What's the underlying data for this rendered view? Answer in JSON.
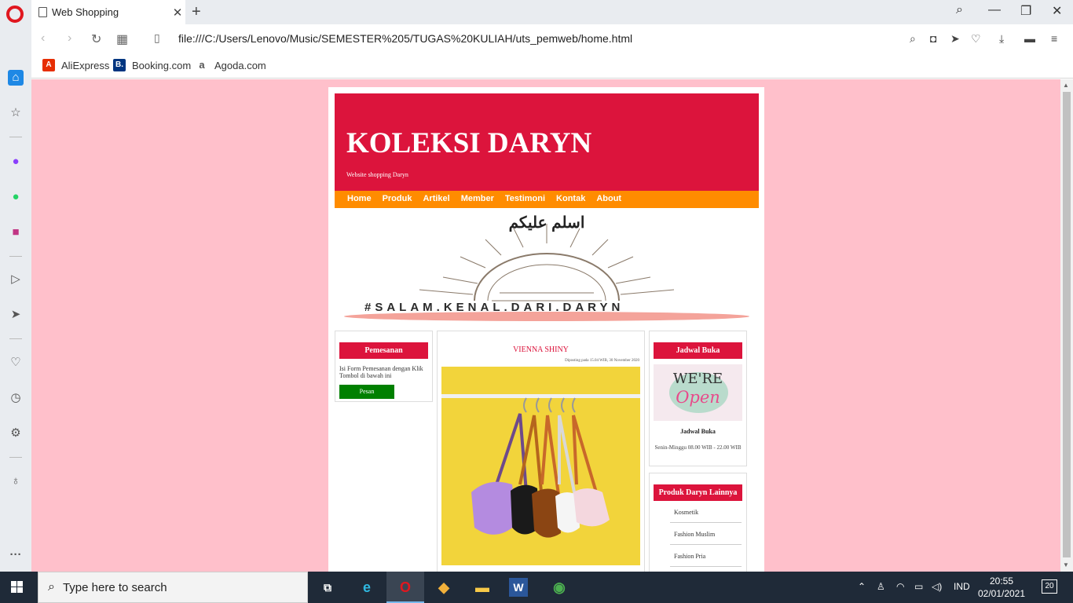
{
  "browser": {
    "tab_title": "Web Shopping",
    "url": "file:///C:/Users/Lenovo/Music/SEMESTER%205/TUGAS%20KULIAH/uts_pemweb/home.html",
    "bookmarks": [
      "AliExpress",
      "Booking.com",
      "Agoda.com"
    ]
  },
  "site": {
    "title": "KOLEKSI DARYN",
    "subtitle": "Website shopping Daryn",
    "menu": [
      "Home",
      "Produk",
      "Artikel",
      "Member",
      "Testimoni",
      "Kontak",
      "About"
    ],
    "banner": {
      "arabic": "اسلم عليكم",
      "tagline": "#SALAM.KENAL.DARI.DARYN"
    },
    "left_panel": {
      "heading": "Pemesanan",
      "text": "Isi Form Pemesanan dengan Klik Tombol di bawah ini",
      "button": "Pesan"
    },
    "product": {
      "title": "VIENNA SHINY",
      "posted": "Diposting pada 15.04 WIB, 30 November 2020"
    },
    "schedule": {
      "heading": "Jadwal Buka",
      "image_text_top": "WE'RE",
      "image_text_bottom": "Open",
      "caption": "Jadwal Buka",
      "hours": "Senin-Minggu 08.00 WIB - 22.00 WIB"
    },
    "other_products": {
      "heading": "Produk Daryn Lainnya",
      "items": [
        "Kosmetik",
        "Fashion Muslim",
        "Fashion Pria"
      ]
    }
  },
  "taskbar": {
    "search_placeholder": "Type here to search",
    "language": "IND",
    "time": "20:55",
    "date": "02/01/2021",
    "notifications": "20"
  },
  "colors": {
    "page_bg": "#ffc0cb",
    "header": "#dc143c",
    "menu": "#ff8c00",
    "order_button": "#008000"
  }
}
